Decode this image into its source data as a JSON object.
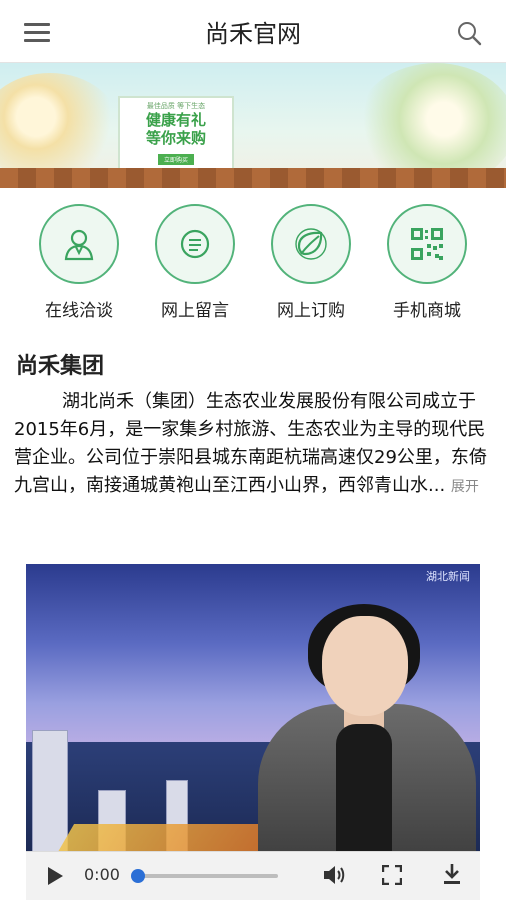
{
  "header": {
    "title": "尚禾官网",
    "menu_icon": "hamburger-menu-icon",
    "search_icon": "search-icon"
  },
  "banner": {
    "small_text": "最佳品质 等下生态",
    "headline_line1": "健康有礼",
    "headline_line2": "等你来购",
    "button_text": "立即购买"
  },
  "quick_links": [
    {
      "label": "在线洽谈",
      "icon": "person-icon"
    },
    {
      "label": "网上留言",
      "icon": "message-icon"
    },
    {
      "label": "网上订购",
      "icon": "leaf-icon"
    },
    {
      "label": "手机商城",
      "icon": "qrcode-icon"
    }
  ],
  "section": {
    "title": "尚禾集团",
    "intro": "湖北尚禾（集团）生态农业发展股份有限公司成立于2015年6月，是一家集乡村旅游、生态农业为主导的现代民营企业。公司位于崇阳县城东南距杭瑞高速仅29公里，东倚九宫山，南接通城黄袍山至江西小山界，西邻青山水...",
    "expand_label": "展开"
  },
  "video": {
    "corner_tag": "湖北新闻",
    "current_time": "0:00",
    "progress": 0.0
  },
  "colors": {
    "accent_green": "#52b37a",
    "player_blue": "#2b6fd6"
  }
}
